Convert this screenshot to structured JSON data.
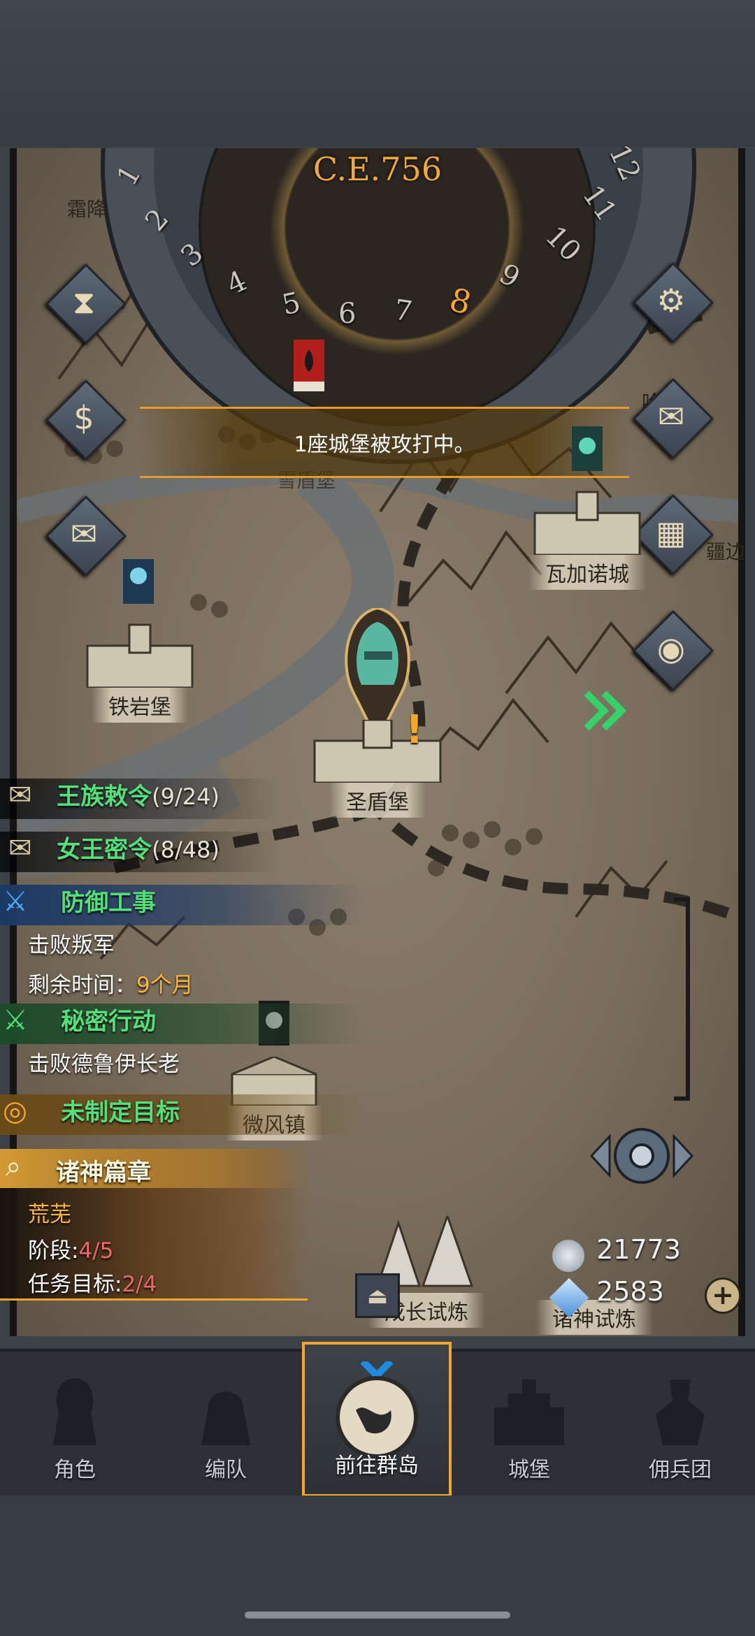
{
  "era": "C.E.756",
  "months": [
    "1",
    "2",
    "3",
    "4",
    "5",
    "6",
    "7",
    "8",
    "9",
    "10",
    "11",
    "12"
  ],
  "active_month": "8",
  "banner_text": "1座城堡被攻打中。",
  "map_fragments": {
    "top_left": "霜降",
    "top_right": "哈",
    "right_edge": "疆边",
    "under_banner": "雪盾堡"
  },
  "cities": {
    "iron_rock": "铁岩堡",
    "wagano": "瓦加诺城",
    "holy_shield": "圣盾堡",
    "breeze": "微风镇",
    "growth_trial": "成长试炼",
    "gods_trial": "诸神试炼"
  },
  "quests": {
    "royal_decree": {
      "title": "王族敕令",
      "progress": "(9/24)"
    },
    "queen_secret": {
      "title": "女王密令",
      "progress": "(8/48)"
    },
    "defense": {
      "title": "防御工事",
      "desc": "击败叛军",
      "time_label": "剩余时间：",
      "time_value": "9个月"
    },
    "secret_op": {
      "title": "秘密行动",
      "desc": "击败德鲁伊长老"
    },
    "unset_goal": {
      "title": "未制定目标"
    },
    "gods_chapter": {
      "title": "诸神篇章",
      "name": "荒芜",
      "stage_label": "阶段:",
      "stage_value": "4/5",
      "target_label": "任务目标:",
      "target_value": "2/4"
    }
  },
  "resources": {
    "silver": "21773",
    "crystal": "2583"
  },
  "nav": [
    "角色",
    "编队",
    "前往群岛",
    "城堡",
    "佣兵团"
  ],
  "colors": {
    "accent": "#f2a72b",
    "quest_green": "#53e07a",
    "progress_red": "#e86a6a"
  }
}
